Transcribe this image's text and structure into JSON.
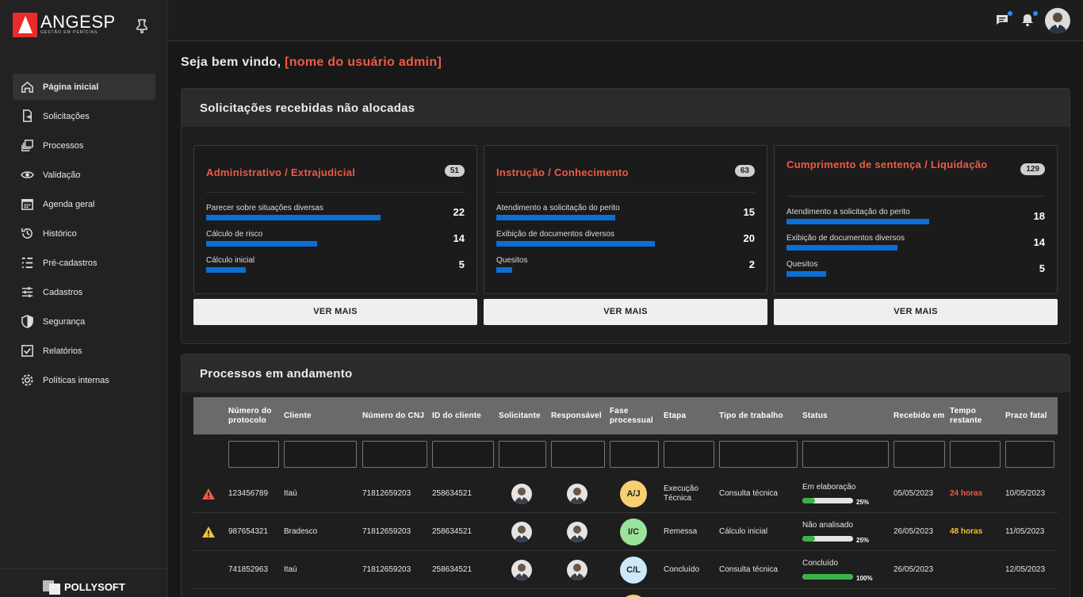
{
  "brand": {
    "name": "ANGESP",
    "tagline": "GESTÃO EM PERÍCIAS"
  },
  "footer_brand": {
    "name": "POLLYSOFT"
  },
  "sidebar": {
    "items": [
      {
        "label": "Página inicial",
        "icon": "home-icon",
        "active": true
      },
      {
        "label": "Solicitações",
        "icon": "file-arrow-icon"
      },
      {
        "label": "Processos",
        "icon": "stack-icon"
      },
      {
        "label": "Validação",
        "icon": "eye-icon"
      },
      {
        "label": "Agenda geral",
        "icon": "calendar-icon"
      },
      {
        "label": "Histórico",
        "icon": "history-icon"
      },
      {
        "label": "Pré-cadastros",
        "icon": "list-tree-icon"
      },
      {
        "label": "Cadastros",
        "icon": "sliders-icon"
      },
      {
        "label": "Segurança",
        "icon": "shield-icon"
      },
      {
        "label": "Relatórios",
        "icon": "checkbox-icon"
      },
      {
        "label": "Políticas internas",
        "icon": "gear-icon"
      }
    ]
  },
  "welcome": {
    "prefix": "Seja bem vindo,",
    "user": "[nome do usuário admin]"
  },
  "unallocated": {
    "title": "Solicitações recebidas não alocadas",
    "button_label": "VER MAIS",
    "cards": [
      {
        "title": "Administrativo / Extrajudicial",
        "count": "51",
        "metrics": [
          {
            "label": "Parecer sobre situações diversas",
            "value": 22
          },
          {
            "label": "Cálculo de risco",
            "value": 14
          },
          {
            "label": "Cálculo inicial",
            "value": 5
          }
        ]
      },
      {
        "title": "Instrução / Conhecimento",
        "count": "63",
        "metrics": [
          {
            "label": "Atendimento a solicitação do perito",
            "value": 15
          },
          {
            "label": "Exibição de documentos diversos",
            "value": 20
          },
          {
            "label": "Quesitos",
            "value": 2
          }
        ]
      },
      {
        "title": "Cumprimento de sentença / Liquidação",
        "count": "129",
        "metrics": [
          {
            "label": "Atendimento a solicitação do perito",
            "value": 18
          },
          {
            "label": "Exibição de documentos diversos",
            "value": 14
          },
          {
            "label": "Quesitos",
            "value": 5
          }
        ]
      }
    ]
  },
  "processes": {
    "title": "Processos em andamento",
    "columns": [
      "Número do protocolo",
      "Cliente",
      "Número do CNJ",
      "ID do cliente",
      "Solicitante",
      "Responsável",
      "Fase processual",
      "Etapa",
      "Tipo de trabalho",
      "Status",
      "Recebido em",
      "Tempo restante",
      "Prazo fatal"
    ],
    "rows": [
      {
        "alert": "red",
        "protocolo": "123456789",
        "cliente": "Itaú",
        "cnj": "71812659203",
        "id_cliente": "258634521",
        "fase": "A/J",
        "fase_color": "#f7d070",
        "etapa": "Execução Técnica",
        "tipo": "Consulta técnica",
        "status": "Em elaboração",
        "progress": 25,
        "progress_label": "25%",
        "recebido": "05/05/2023",
        "tempo": "24 horas",
        "tempo_color": "red",
        "prazo": "10/05/2023"
      },
      {
        "alert": "yellow",
        "protocolo": "987654321",
        "cliente": "Bradesco",
        "cnj": "71812659203",
        "id_cliente": "258634521",
        "fase": "I/C",
        "fase_color": "#9be39b",
        "etapa": "Remessa",
        "tipo": "Cálculo inicial",
        "status": "Não analisado",
        "progress": 25,
        "progress_label": "25%",
        "recebido": "26/05/2023",
        "tempo": "48 horas",
        "tempo_color": "yellow",
        "prazo": "11/05/2023"
      },
      {
        "alert": "",
        "protocolo": "741852963",
        "cliente": "Itaú",
        "cnj": "71812659203",
        "id_cliente": "258634521",
        "fase": "C/L",
        "fase_color": "#cde8fb",
        "etapa": "Concluído",
        "tipo": "Consulta técnica",
        "status": "Concluído",
        "progress": 100,
        "progress_label": "100%",
        "recebido": "26/05/2023",
        "tempo": "",
        "tempo_color": "",
        "prazo": "12/05/2023"
      }
    ]
  }
}
